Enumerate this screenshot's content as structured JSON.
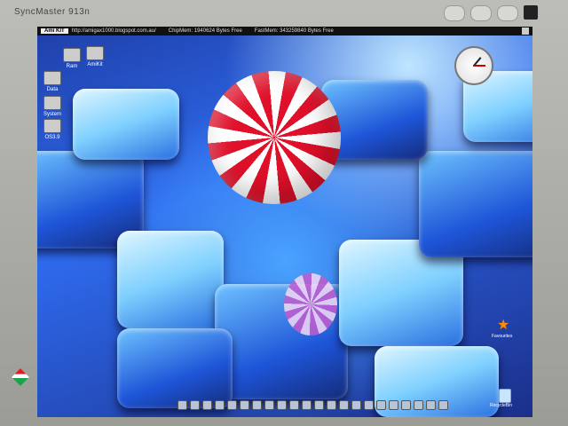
{
  "monitor": {
    "brand_text": "SyncMaster 913n"
  },
  "menubar": {
    "logo": "Ami KIT",
    "url": "http://amigax1000.blogspot.com.au/",
    "chipmem": "ChipMem: 1940624 Bytes Free",
    "fastmem": "FastMem: 343259840 Bytes Free"
  },
  "desktop_icons": [
    {
      "label": "Ram"
    },
    {
      "label": "AmiKit"
    },
    {
      "label": "Data"
    },
    {
      "label": "System"
    },
    {
      "label": "OS3.9"
    }
  ],
  "right_icons": {
    "favourites": "Favourites",
    "recycle": "RecycleBin"
  },
  "colors": {
    "accent": "#e0102a",
    "background": "#2f6cf0"
  }
}
